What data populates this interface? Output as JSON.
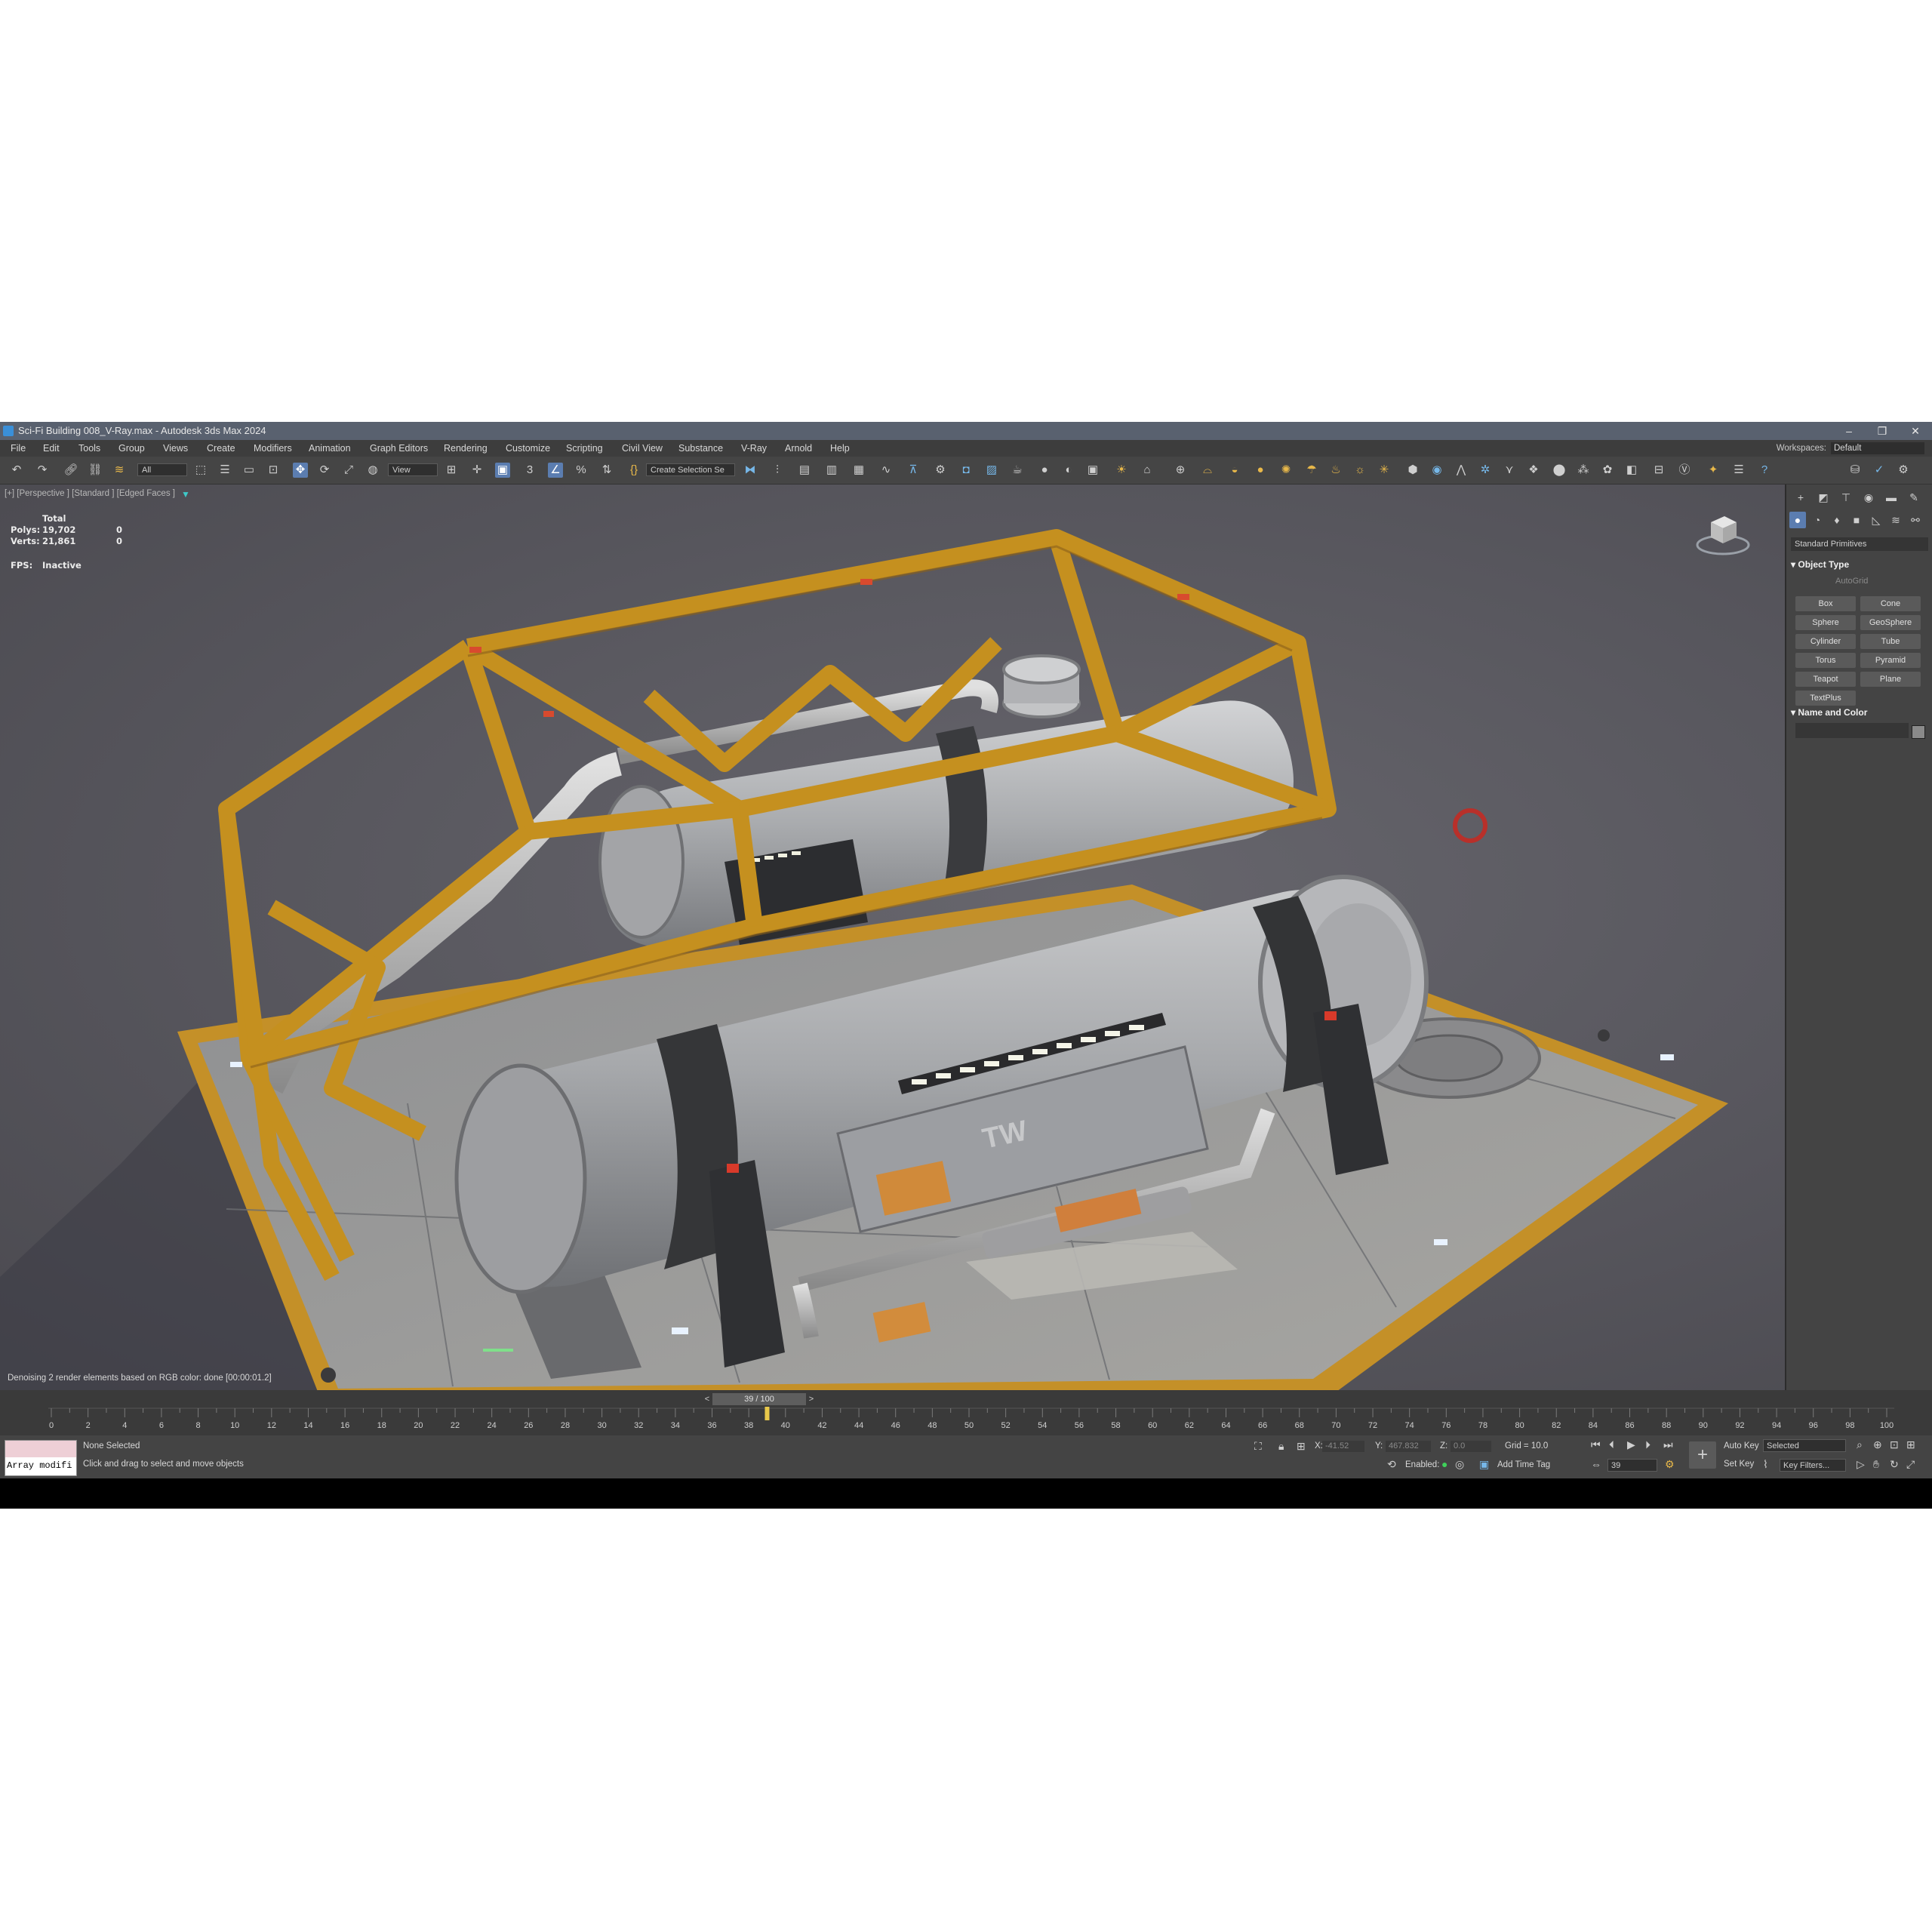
{
  "window": {
    "title": "Sci-Fi Building 008_V-Ray.max - Autodesk 3ds Max 2024",
    "minimize": "–",
    "restore": "❐",
    "close": "✕"
  },
  "menu": [
    "File",
    "Edit",
    "Tools",
    "Group",
    "Views",
    "Create",
    "Modifiers",
    "Animation",
    "Graph Editors",
    "Rendering",
    "Customize",
    "Scripting",
    "Civil View",
    "Substance",
    "V-Ray",
    "Arnold",
    "Help"
  ],
  "workspace": {
    "label": "Workspaces:",
    "value": "Default"
  },
  "toolbar": {
    "selection_filter": "All",
    "ref_coord": "View",
    "named_selection": "Create Selection Se"
  },
  "viewport": {
    "label": "[+] [Perspective ] [Standard ] [Edged Faces ]",
    "stats": {
      "header": "Total",
      "polys_label": "Polys:",
      "polys_value": "19,702",
      "polys_sel": "0",
      "verts_label": "Verts:",
      "verts_value": "21,861",
      "verts_sel": "0",
      "fps_label": "FPS:",
      "fps_value": "Inactive"
    },
    "status": "Denoising 2 render elements based on RGB color: done [00:00:01.2]",
    "decal": "TW"
  },
  "command_panel": {
    "category": "Standard Primitives",
    "object_type_title": "Object Type",
    "autogrid": "AutoGrid",
    "buttons": [
      "Box",
      "Cone",
      "Sphere",
      "GeoSphere",
      "Cylinder",
      "Tube",
      "Torus",
      "Pyramid",
      "Teapot",
      "Plane",
      "TextPlus"
    ],
    "name_color_title": "Name and Color"
  },
  "timeline": {
    "slider": "39 / 100",
    "prev": "<",
    "next": ">",
    "ticks": [
      "0",
      "2",
      "4",
      "6",
      "8",
      "10",
      "12",
      "14",
      "16",
      "18",
      "20",
      "22",
      "24",
      "26",
      "28",
      "30",
      "32",
      "34",
      "36",
      "38",
      "40",
      "42",
      "44",
      "46",
      "48",
      "50",
      "52",
      "54",
      "56",
      "58",
      "60",
      "62",
      "64",
      "66",
      "68",
      "70",
      "72",
      "74",
      "76",
      "78",
      "80",
      "82",
      "84",
      "86",
      "88",
      "90",
      "92",
      "94",
      "96",
      "98",
      "100"
    ]
  },
  "status": {
    "listener_text": "Array modifi",
    "selection": "None Selected",
    "prompt": "Click and drag to select and move objects",
    "x_label": "X:",
    "x_value": "-41.52",
    "y_label": "Y:",
    "y_value": "467.832",
    "z_label": "Z:",
    "z_value": "0.0",
    "grid": "Grid = 10.0",
    "enabled": "Enabled:",
    "add_time_tag": "Add Time Tag",
    "auto_key": "Auto Key",
    "selected": "Selected",
    "set_key": "Set Key",
    "key_filters": "Key Filters...",
    "frame": "39"
  },
  "colors": {
    "frame_yellow": "#c8901c",
    "tank_gray": "#9a9ca0",
    "accent_blue": "#5b7db0"
  }
}
